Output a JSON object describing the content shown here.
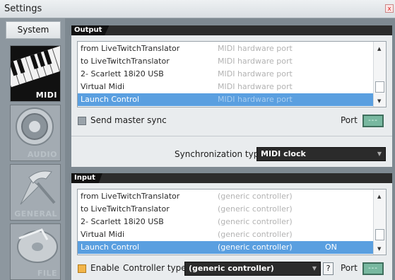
{
  "window": {
    "title": "Settings",
    "close_glyph": "x"
  },
  "sidebar": {
    "system_tab": "System",
    "categories": [
      {
        "label": "MIDI",
        "icon": "midi-keyboard-icon"
      },
      {
        "label": "AUDIO",
        "icon": "speaker-icon"
      },
      {
        "label": "GENERAL",
        "icon": "general-tools-icon"
      },
      {
        "label": "FILE",
        "icon": "file-disc-icon"
      }
    ]
  },
  "output": {
    "header": "Output",
    "rows": [
      {
        "name": "from LiveTwitchTranslator",
        "type": "MIDI hardware port"
      },
      {
        "name": "to LiveTwitchTranslator",
        "type": "MIDI hardware port"
      },
      {
        "name": "2- Scarlett 18i20 USB",
        "type": "MIDI hardware port"
      },
      {
        "name": "Virtual Midi",
        "type": "MIDI hardware port"
      },
      {
        "name": "Launch Control",
        "type": "MIDI hardware port"
      }
    ],
    "send_master_sync": "Send master sync",
    "port_label": "Port",
    "port_value": "---",
    "sync_label": "Synchronization type:",
    "sync_value": "MIDI clock"
  },
  "input": {
    "header": "Input",
    "rows": [
      {
        "name": "from LiveTwitchTranslator",
        "type": "(generic controller)",
        "status": ""
      },
      {
        "name": "to LiveTwitchTranslator",
        "type": "(generic controller)",
        "status": ""
      },
      {
        "name": "2- Scarlett 18i20 USB",
        "type": "(generic controller)",
        "status": ""
      },
      {
        "name": "Virtual Midi",
        "type": "(generic controller)",
        "status": ""
      },
      {
        "name": "Launch Control",
        "type": "(generic controller)",
        "status": "ON"
      }
    ],
    "enable_label": "Enable",
    "controller_type_label": "Controller type:",
    "controller_type_value": "(generic controller)",
    "help_label": "?",
    "port_label": "Port",
    "port_value": "---"
  },
  "colors": {
    "selection": "#5a9fe0",
    "port_box": "#78b8a0",
    "enable_check": "#f2b54a"
  }
}
